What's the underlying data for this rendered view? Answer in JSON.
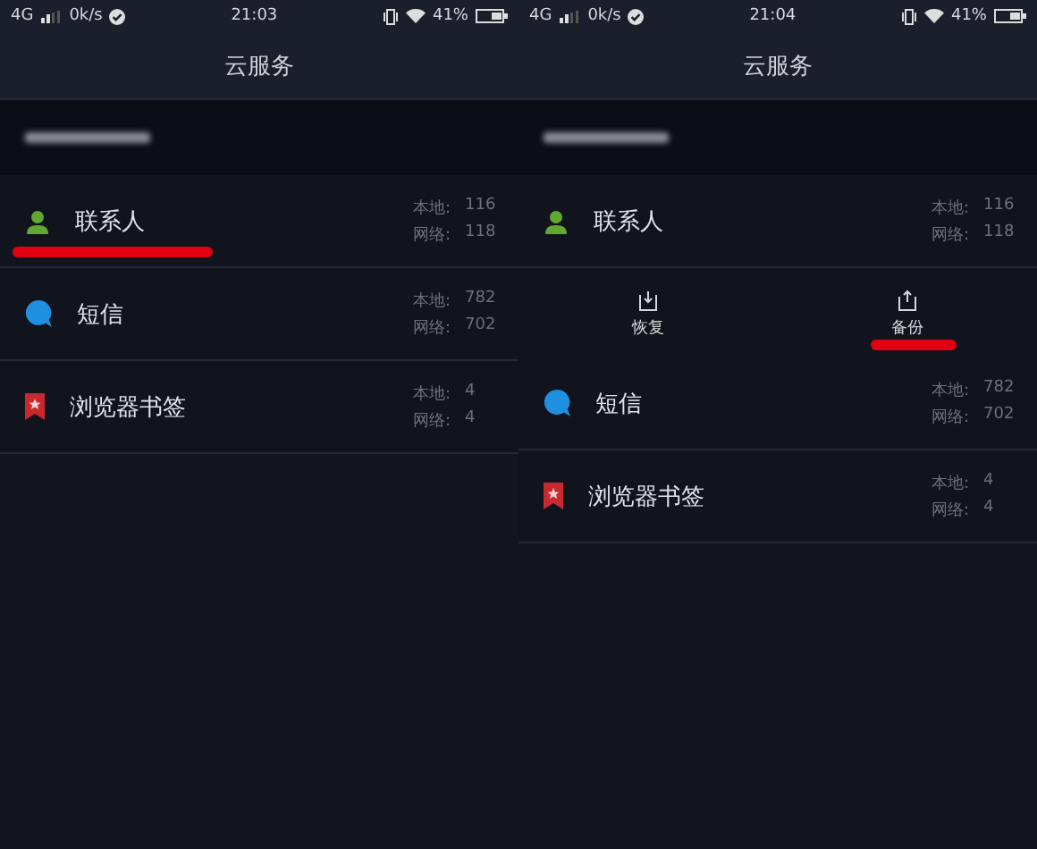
{
  "screens": [
    {
      "status_bar": {
        "network": "4G",
        "speed": "0k/s",
        "time": "21:03",
        "battery": "41%"
      },
      "title": "云服务",
      "items": [
        {
          "kind": "contacts",
          "name": "联系人",
          "local_label": "本地:",
          "local": "116",
          "cloud_label": "网络:",
          "cloud": "118",
          "underlined": true
        },
        {
          "kind": "messages",
          "name": "短信",
          "local_label": "本地:",
          "local": "782",
          "cloud_label": "网络:",
          "cloud": "702",
          "underlined": false
        },
        {
          "kind": "bookmarks",
          "name": "浏览器书签",
          "local_label": "本地:",
          "local": "4",
          "cloud_label": "网络:",
          "cloud": "4",
          "underlined": false
        }
      ]
    },
    {
      "status_bar": {
        "network": "4G",
        "speed": "0k/s",
        "time": "21:04",
        "battery": "41%"
      },
      "title": "云服务",
      "items": [
        {
          "kind": "contacts",
          "name": "联系人",
          "local_label": "本地:",
          "local": "116",
          "cloud_label": "网络:",
          "cloud": "118",
          "underlined": false,
          "actions": [
            {
              "kind": "restore",
              "label": "恢复",
              "underlined": false
            },
            {
              "kind": "backup",
              "label": "备份",
              "underlined": true
            }
          ]
        },
        {
          "kind": "messages",
          "name": "短信",
          "local_label": "本地:",
          "local": "782",
          "cloud_label": "网络:",
          "cloud": "702",
          "underlined": false
        },
        {
          "kind": "bookmarks",
          "name": "浏览器书签",
          "local_label": "本地:",
          "local": "4",
          "cloud_label": "网络:",
          "cloud": "4",
          "underlined": false
        }
      ]
    }
  ]
}
